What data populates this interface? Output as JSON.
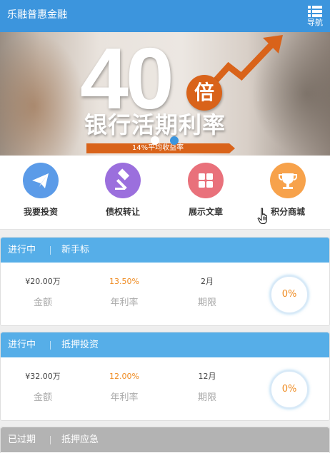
{
  "header": {
    "title": "乐融普惠金融",
    "nav_label": "导航",
    "nav_icon": "list-menu-icon"
  },
  "banner": {
    "big_number": "40",
    "multiplier": "倍",
    "headline": "银行活期利率",
    "ribbon_text": "14%平均收益率",
    "slide_count": 2,
    "active_slide": 2,
    "accent_color": "#d9631a"
  },
  "quick_menu": [
    {
      "label": "我要投资",
      "icon": "paper-plane-icon",
      "color": "#5b9be8"
    },
    {
      "label": "债权转让",
      "icon": "gavel-icon",
      "color": "#9b6fdd"
    },
    {
      "label": "展示文章",
      "icon": "grid-icon",
      "color": "#e9717b"
    },
    {
      "label": "积分商城",
      "icon": "trophy-icon",
      "color": "#f7a24b"
    }
  ],
  "loans": [
    {
      "status": "进行中",
      "name": "新手标",
      "amount": "¥20.00万",
      "amount_label": "金额",
      "rate": "13.50%",
      "rate_label": "年利率",
      "term": "2月",
      "term_label": "期限",
      "progress": "0%"
    },
    {
      "status": "进行中",
      "name": "抵押投资",
      "amount": "¥32.00万",
      "amount_label": "金额",
      "rate": "12.00%",
      "rate_label": "年利率",
      "term": "12月",
      "term_label": "期限",
      "progress": "0%"
    },
    {
      "status": "已过期",
      "name": "抵押应急"
    }
  ],
  "colors": {
    "header_blue": "#3c95dd",
    "card_head_blue": "#56aee8",
    "expired_gray": "#b3b3b3",
    "rate_orange": "#ef8a1f"
  }
}
